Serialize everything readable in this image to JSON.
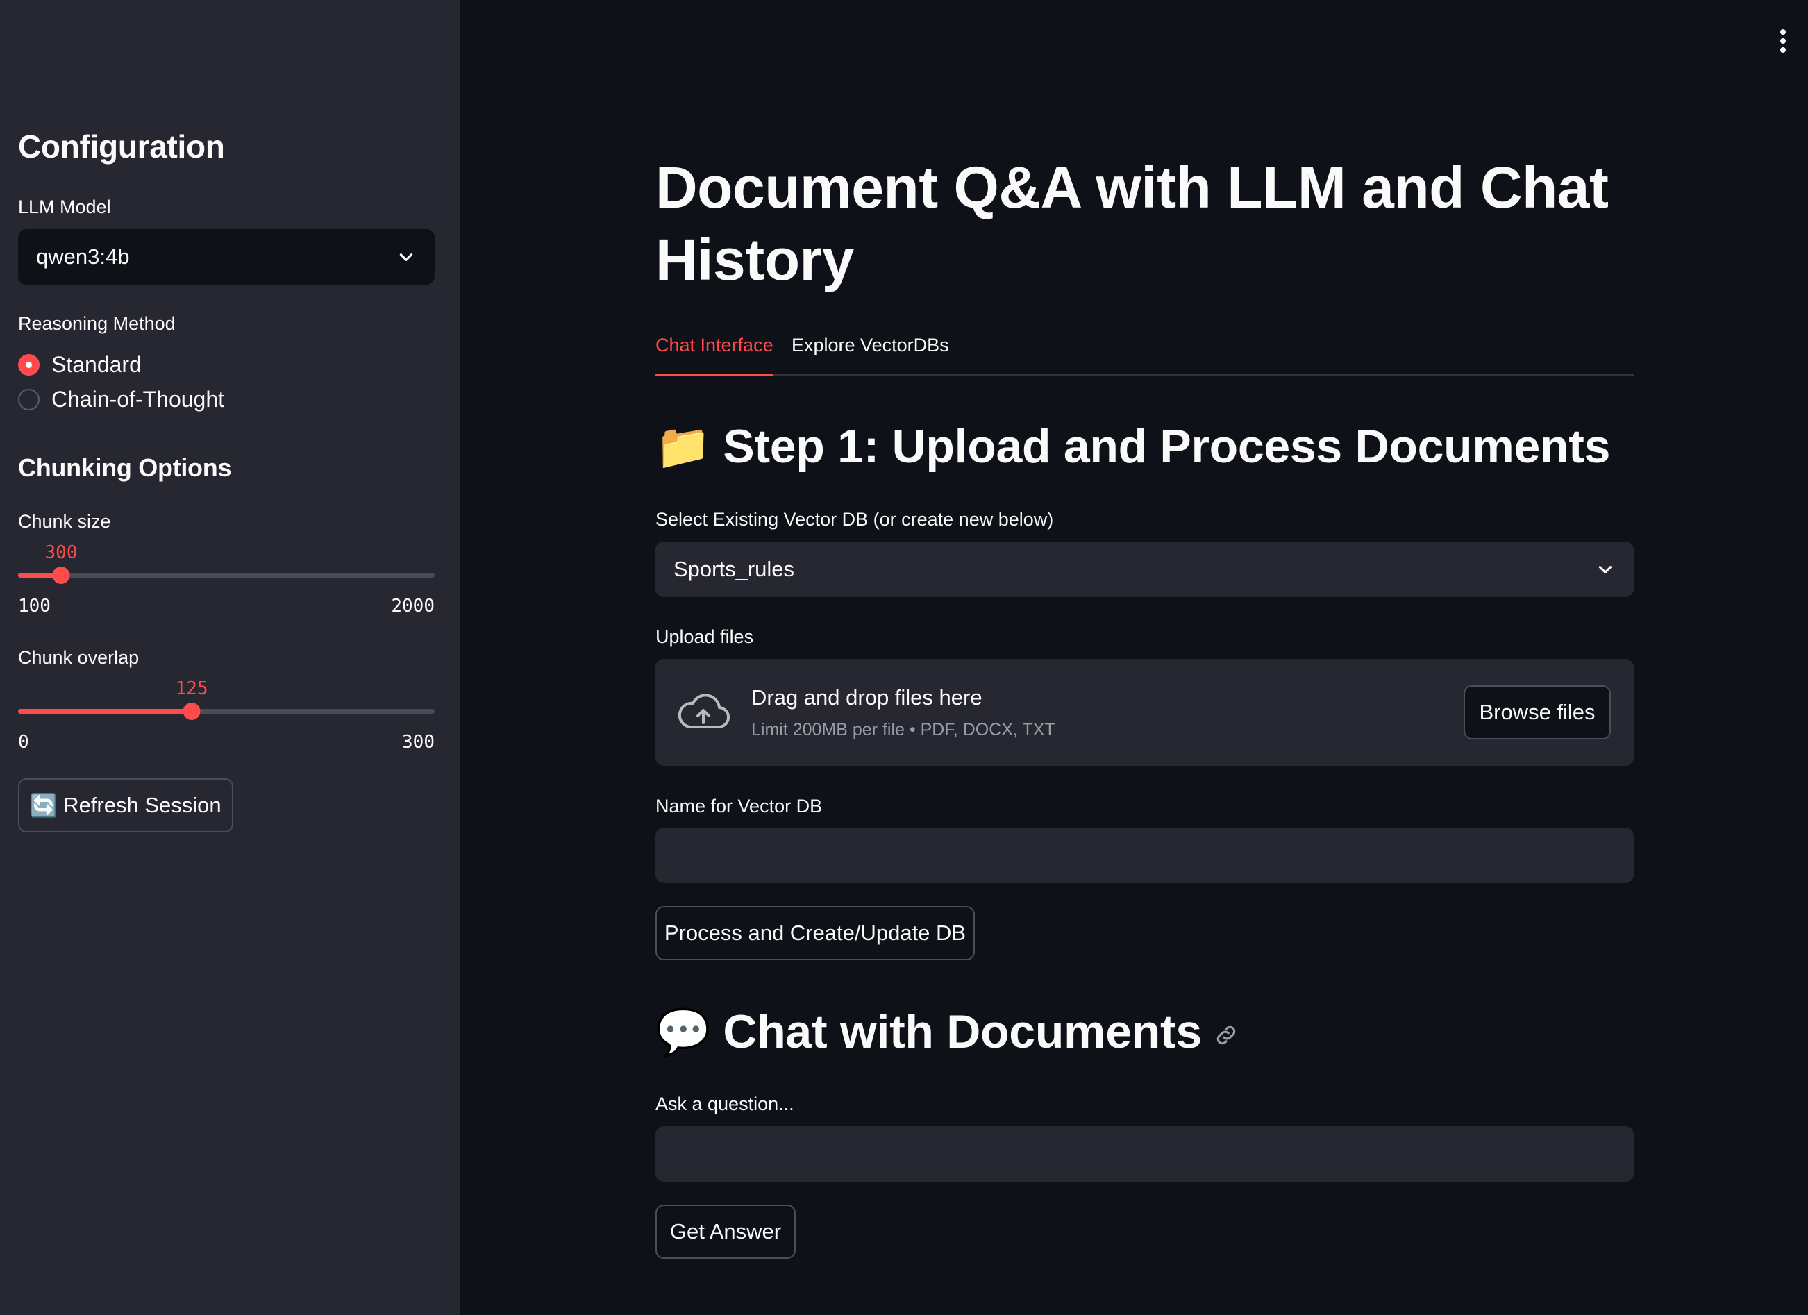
{
  "sidebar": {
    "heading": "Configuration",
    "llm_label": "LLM Model",
    "llm_value": "qwen3:4b",
    "reasoning_label": "Reasoning Method",
    "reasoning_options": [
      "Standard",
      "Chain-of-Thought"
    ],
    "reasoning_selected": "Standard",
    "chunking_heading": "Chunking Options",
    "chunk_size": {
      "label": "Chunk size",
      "value": "300",
      "min": "100",
      "max": "2000"
    },
    "chunk_overlap": {
      "label": "Chunk overlap",
      "value": "125",
      "min": "0",
      "max": "300"
    },
    "refresh_label": "Refresh Session",
    "refresh_icon": "🔄"
  },
  "main": {
    "title": "Document Q&A with LLM and Chat History",
    "tabs": [
      {
        "label": "Chat Interface",
        "active": true
      },
      {
        "label": "Explore VectorDBs",
        "active": false
      }
    ],
    "step1": {
      "heading": "Step 1: Upload and Process Documents",
      "emoji": "📁",
      "vector_db_label": "Select Existing Vector DB (or create new below)",
      "vector_db_value": "Sports_rules",
      "upload_label": "Upload files",
      "dropzone_title": "Drag and drop files here",
      "dropzone_sub": "Limit 200MB per file • PDF, DOCX, TXT",
      "browse_label": "Browse files",
      "name_label": "Name for Vector DB",
      "name_value": "",
      "process_label": "Process and Create/Update DB"
    },
    "chat": {
      "heading": "Chat with Documents",
      "emoji": "💬",
      "question_label": "Ask a question...",
      "question_value": "",
      "answer_label": "Get Answer"
    }
  },
  "colors": {
    "accent": "#ff4b4b",
    "background": "#0e1117",
    "sidebar": "#262730",
    "input": "#262730"
  }
}
